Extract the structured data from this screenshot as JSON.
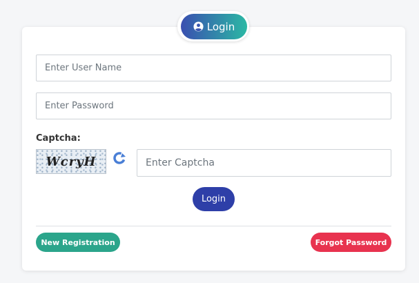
{
  "header": {
    "login_badge_label": "Login",
    "login_badge_icon": "user-circle-icon"
  },
  "form": {
    "username_placeholder": "Enter User Name",
    "password_placeholder": "Enter Password",
    "captcha_label": "Captcha:",
    "captcha_text": "WcryH",
    "captcha_refresh_icon": "refresh-icon",
    "captcha_placeholder": "Enter Captcha",
    "submit_label": "Login"
  },
  "footer": {
    "new_registration_label": "New Registration",
    "forgot_password_label": "Forgot Password"
  },
  "colors": {
    "badge_gradient_start": "#3a4fb0",
    "badge_gradient_end": "#2bb8a4",
    "submit": "#2e3fa8",
    "new_registration": "#2ba58b",
    "forgot_password": "#e8334f"
  }
}
